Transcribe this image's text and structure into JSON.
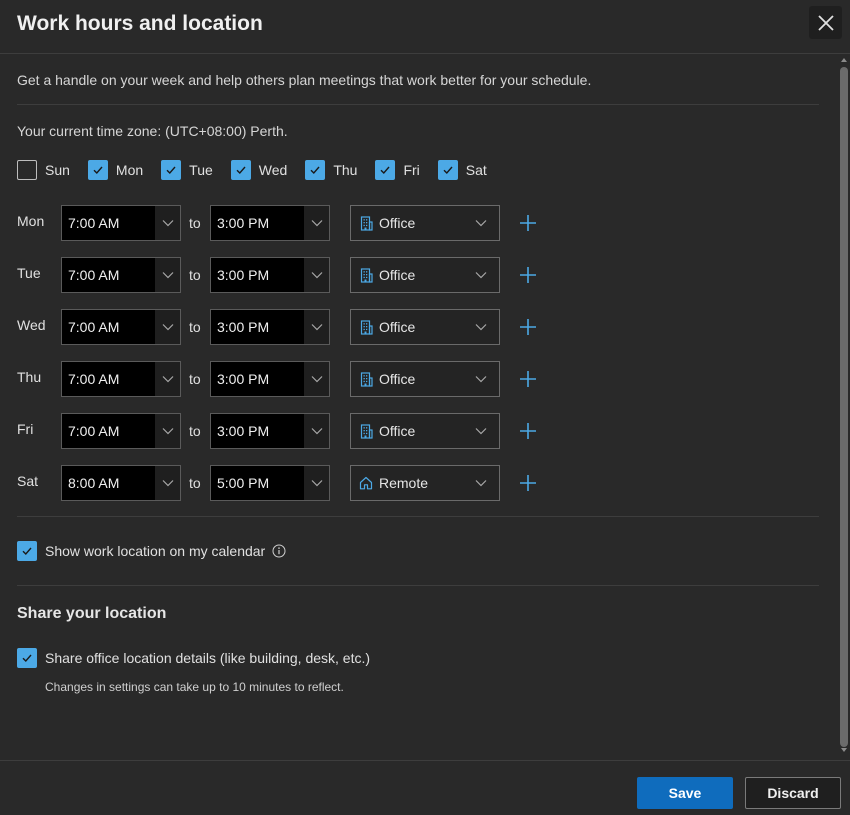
{
  "dialog": {
    "title": "Work hours and location",
    "intro": "Get a handle on your week and help others plan meetings that work better for your schedule.",
    "timezone": "Your current time zone: (UTC+08:00) Perth."
  },
  "days": [
    {
      "label": "Sun",
      "checked": false
    },
    {
      "label": "Mon",
      "checked": true
    },
    {
      "label": "Tue",
      "checked": true
    },
    {
      "label": "Wed",
      "checked": true
    },
    {
      "label": "Thu",
      "checked": true
    },
    {
      "label": "Fri",
      "checked": true
    },
    {
      "label": "Sat",
      "checked": true
    }
  ],
  "to_label": "to",
  "schedule": [
    {
      "day": "Mon",
      "start": "7:00 AM",
      "end": "3:00 PM",
      "location": "Office",
      "location_icon": "building-icon"
    },
    {
      "day": "Tue",
      "start": "7:00 AM",
      "end": "3:00 PM",
      "location": "Office",
      "location_icon": "building-icon"
    },
    {
      "day": "Wed",
      "start": "7:00 AM",
      "end": "3:00 PM",
      "location": "Office",
      "location_icon": "building-icon"
    },
    {
      "day": "Thu",
      "start": "7:00 AM",
      "end": "3:00 PM",
      "location": "Office",
      "location_icon": "building-icon"
    },
    {
      "day": "Fri",
      "start": "7:00 AM",
      "end": "3:00 PM",
      "location": "Office",
      "location_icon": "building-icon"
    },
    {
      "day": "Sat",
      "start": "8:00 AM",
      "end": "5:00 PM",
      "location": "Remote",
      "location_icon": "home-icon"
    }
  ],
  "show_location": {
    "label": "Show work location on my calendar",
    "checked": true
  },
  "share": {
    "title": "Share your location",
    "checkbox_label": "Share office location details (like building, desk, etc.)",
    "checked": true,
    "note": "Changes in settings can take up to 10 minutes to reflect."
  },
  "footer": {
    "save_label": "Save",
    "discard_label": "Discard"
  },
  "colors": {
    "accent": "#4ca9e6",
    "primary_button": "#0f6cbd",
    "background": "#292929"
  }
}
